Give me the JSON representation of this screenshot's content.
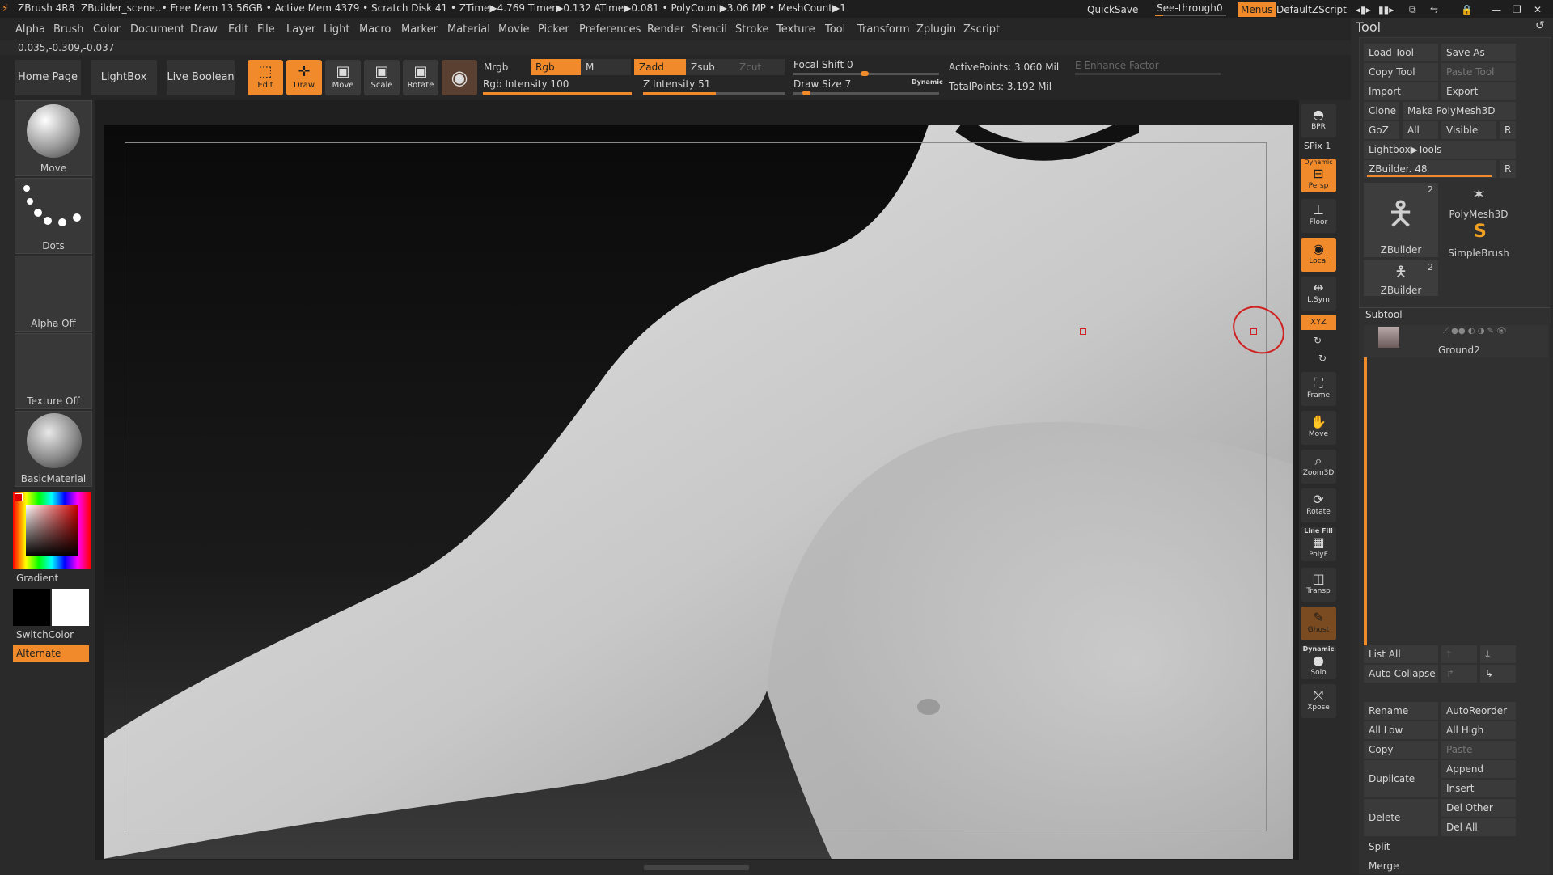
{
  "titlebar": {
    "app": "ZBrush 4R8",
    "scene": "ZBuilder_scene",
    "status": "..• Free Mem 13.56GB • Active Mem 4379 • Scratch Disk 41 • ZTime▶4.769 Timer▶0.132 ATime▶0.081 • PolyCount▶3.06 MP • MeshCount▶1",
    "quicksave": "QuickSave",
    "seethrough_label": "See-through",
    "seethrough_value": "0",
    "menus": "Menus",
    "script": "DefaultZScript"
  },
  "menubar": [
    "Alpha",
    "Brush",
    "Color",
    "Document",
    "Draw",
    "Edit",
    "File",
    "Layer",
    "Light",
    "Macro",
    "Marker",
    "Material",
    "Movie",
    "Picker",
    "Preferences",
    "Render",
    "Stencil",
    "Stroke",
    "Texture",
    "Tool",
    "Transform",
    "Zplugin",
    "Zscript"
  ],
  "coords": "0.035,-0.309,-0.037",
  "toolbar": {
    "home_page": "Home Page",
    "lightbox": "LightBox",
    "live_boolean": "Live Boolean",
    "edit": "Edit",
    "draw": "Draw",
    "move": "Move",
    "scale": "Scale",
    "rotate": "Rotate",
    "mrgb": "Mrgb",
    "rgb": "Rgb",
    "m": "M",
    "rgb_intensity": "Rgb Intensity 100",
    "rgb_intensity_value": 100,
    "zadd": "Zadd",
    "zsub": "Zsub",
    "zcut": "Zcut",
    "z_intensity": "Z Intensity 51",
    "z_intensity_value": 51,
    "focal_shift": "Focal Shift 0",
    "draw_size": "Draw Size 7",
    "dynamic": "Dynamic",
    "active_points": "ActivePoints: 3.060 Mil",
    "total_points": "TotalPoints: 3.192 Mil",
    "enhance_factor": "E Enhance Factor"
  },
  "lefttray": {
    "move": "Move",
    "dots": "Dots",
    "alpha_off": "Alpha Off",
    "texture_off": "Texture Off",
    "material": "BasicMaterial",
    "gradient": "Gradient",
    "switchcolor": "SwitchColor",
    "alternate": "Alternate"
  },
  "shelf": {
    "bpr": "BPR",
    "spix": "SPix 1",
    "persp": "Persp",
    "persp_top": "Dynamic",
    "floor": "Floor",
    "local": "Local",
    "lsym": "L.Sym",
    "xyz": "XYZ",
    "frame": "Frame",
    "move": "Move",
    "zoom3d": "Zoom3D",
    "rotate": "Rotate",
    "linefill": "Line Fill",
    "polyf": "PolyF",
    "transp": "Transp",
    "ghost": "Ghost",
    "dynamic": "Dynamic",
    "solo": "Solo",
    "xpose": "Xpose"
  },
  "tool": {
    "title": "Tool",
    "load_tool": "Load Tool",
    "save_as": "Save As",
    "copy_tool": "Copy Tool",
    "paste_tool": "Paste Tool",
    "import": "Import",
    "export": "Export",
    "clone": "Clone",
    "make_polymesh": "Make PolyMesh3D",
    "goz": "GoZ",
    "all": "All",
    "visible": "Visible",
    "r": "R",
    "lightbox_tools": "Lightbox▶Tools",
    "zbuilder_slider": "ZBuilder. 48",
    "thumb1_label": "ZBuilder",
    "thumb1_count": "2",
    "polymesh3d": "PolyMesh3D",
    "simplebrush": "SimpleBrush",
    "thumb2_label": "ZBuilder",
    "thumb2_count": "2"
  },
  "subtool": {
    "title": "Subtool",
    "item": "Ground2",
    "list_all": "List All",
    "auto_collapse": "Auto Collapse",
    "rename": "Rename",
    "autoreorder": "AutoReorder",
    "all_low": "All Low",
    "all_high": "All High",
    "copy": "Copy",
    "paste": "Paste",
    "duplicate": "Duplicate",
    "append": "Append",
    "insert": "Insert",
    "delete": "Delete",
    "del_other": "Del Other",
    "del_all": "Del All",
    "split": "Split",
    "merge": "Merge"
  },
  "colors": {
    "accent": "#f08a2a",
    "panel": "#2c2c2c",
    "button": "#3a3a3a"
  }
}
